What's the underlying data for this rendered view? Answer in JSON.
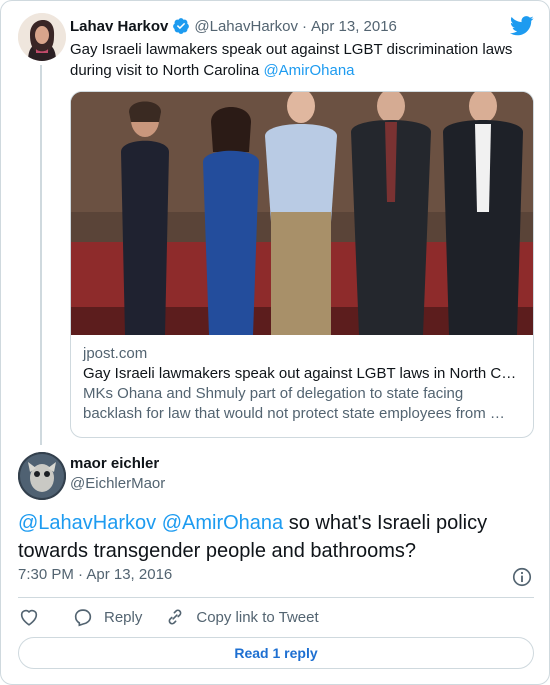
{
  "parent_tweet": {
    "author_name": "Lahav Harkov",
    "author_handle": "@LahavHarkov",
    "separator": "·",
    "date": "Apr 13, 2016",
    "text": "Gay Israeli lawmakers speak out against LGBT discrimination laws during visit to North Carolina",
    "mention": "@AmirOhana",
    "link_card": {
      "domain": "jpost.com",
      "title": "Gay Israeli lawmakers speak out against LGBT laws in North C…",
      "description": "MKs Ohana and Shmuly part of delegation to state facing backlash for law that would not protect state employees from …"
    }
  },
  "reply_tweet": {
    "author_name": "maor eichler",
    "author_handle": "@EichlerMaor",
    "mention_1": "@LahavHarkov",
    "mention_2": "@AmirOhana",
    "text": "so what's Israeli policy towards transgender people and bathrooms?",
    "timestamp": "7:30 PM · Apr 13, 2016"
  },
  "actions": {
    "reply_label": "Reply",
    "copy_link_label": "Copy link to Tweet"
  },
  "read_replies_label": "Read 1 reply",
  "colors": {
    "accent": "#1d9bf0",
    "text": "#0f1419",
    "secondary": "#536471",
    "border": "#cfd9de"
  },
  "icons": [
    "verified-badge-icon",
    "twitter-bird-icon",
    "info-icon",
    "heart-icon",
    "reply-icon",
    "link-icon"
  ]
}
